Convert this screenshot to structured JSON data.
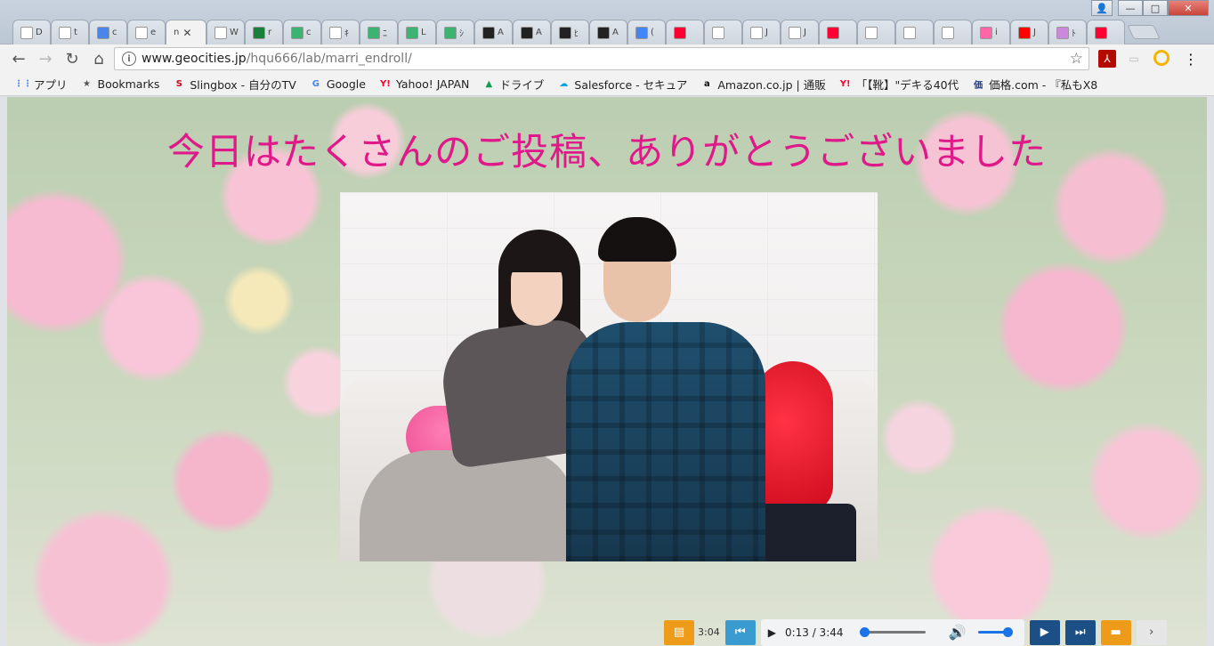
{
  "tabs": [
    {
      "text": "D",
      "icon": "doc-icon",
      "color": "#ffffff"
    },
    {
      "text": "t",
      "icon": "drive-icon",
      "color": "#ffffff"
    },
    {
      "text": "c",
      "icon": "docs-icon",
      "color": "#4a86e8"
    },
    {
      "text": "e",
      "icon": "doc-icon",
      "color": "#ffffff"
    },
    {
      "text": "n",
      "icon": "",
      "color": "#f2f2f2",
      "active": true
    },
    {
      "text": "W",
      "icon": "wiki-icon",
      "color": "#ffffff"
    },
    {
      "text": "r",
      "icon": "sheets-icon",
      "color": "#188038"
    },
    {
      "text": "c",
      "icon": "green-circle-icon",
      "color": "#3cb371"
    },
    {
      "text": "ｷ",
      "icon": "wreath-icon",
      "color": "#ffffff"
    },
    {
      "text": "ﾆ",
      "icon": "green-circle-icon",
      "color": "#3cb371"
    },
    {
      "text": "L",
      "icon": "green-circle-icon",
      "color": "#3cb371"
    },
    {
      "text": "ｼ",
      "icon": "green-circle-icon",
      "color": "#3cb371"
    },
    {
      "text": "A",
      "icon": "dark-badge-icon",
      "color": "#222222"
    },
    {
      "text": "A",
      "icon": "dark-badge-icon",
      "color": "#222222"
    },
    {
      "text": "ﾋ",
      "icon": "dark-badge-icon",
      "color": "#222222"
    },
    {
      "text": "A",
      "icon": "dark-badge-icon",
      "color": "#222222"
    },
    {
      "text": "(",
      "icon": "translate-icon",
      "color": "#4285f4"
    },
    {
      "text": "",
      "icon": "yahoo-icon",
      "color": "#ff0033"
    },
    {
      "text": "",
      "icon": "doc-icon",
      "color": "#ffffff"
    },
    {
      "text": "J",
      "icon": "doc-icon",
      "color": "#ffffff"
    },
    {
      "text": "J",
      "icon": "doc-icon",
      "color": "#ffffff"
    },
    {
      "text": "",
      "icon": "yahoo-icon",
      "color": "#ff0033"
    },
    {
      "text": "",
      "icon": "doc-icon",
      "color": "#ffffff"
    },
    {
      "text": "",
      "icon": "doc-icon",
      "color": "#ffffff"
    },
    {
      "text": "",
      "icon": "doc-icon",
      "color": "#ffffff"
    },
    {
      "text": "i",
      "icon": "pink-face-icon",
      "color": "#ff66aa"
    },
    {
      "text": "J",
      "icon": "youtube-icon",
      "color": "#ff0000"
    },
    {
      "text": "ﾄ",
      "icon": "flower-icon",
      "color": "#cc88dd"
    },
    {
      "text": "",
      "icon": "yahoo-icon",
      "color": "#ff0033"
    }
  ],
  "window": {
    "minimize": "—",
    "maximize": "□",
    "close": "✕",
    "user": "👤"
  },
  "toolbar": {
    "back": "←",
    "forward": "→",
    "reload": "↻",
    "home": "⌂",
    "url_host": "www.geocities.jp",
    "url_path": "/hqu666/lab/marri_endroll/",
    "info": "i",
    "star": "☆",
    "menu": "⋮"
  },
  "bookmarks": [
    {
      "label": "アプリ",
      "icon": "apps-icon",
      "glyph": "⋮⋮",
      "color": "#4285f4"
    },
    {
      "label": "Bookmarks",
      "icon": "star-icon",
      "glyph": "★",
      "color": "#555555"
    },
    {
      "label": "Slingbox - 自分のTV",
      "icon": "slingbox-icon",
      "glyph": "S",
      "color": "#d0021b"
    },
    {
      "label": "Google",
      "icon": "google-icon",
      "glyph": "G",
      "color": "#4285f4"
    },
    {
      "label": "Yahoo! JAPAN",
      "icon": "yahoo-icon",
      "glyph": "Y!",
      "color": "#ff0033"
    },
    {
      "label": "ドライブ",
      "icon": "drive-icon",
      "glyph": "▲",
      "color": "#0f9d58"
    },
    {
      "label": "Salesforce - セキュア",
      "icon": "salesforce-icon",
      "glyph": "☁",
      "color": "#00a1e0"
    },
    {
      "label": "Amazon.co.jp | 通販",
      "icon": "amazon-icon",
      "glyph": "a",
      "color": "#111111"
    },
    {
      "label": "「【靴】\"デキる40代",
      "icon": "yahoo-icon",
      "glyph": "Y!",
      "color": "#ff0033"
    },
    {
      "label": "価格.com - 『私もX8",
      "icon": "kakaku-icon",
      "glyph": "価",
      "color": "#1f3f8f"
    }
  ],
  "page": {
    "headline": "今日はたくさんのご投稿、ありがとうございました"
  },
  "player": {
    "list_btn": "▤",
    "prev_btn": "⏮",
    "play": "▶",
    "time": "0:13 / 3:44",
    "progress": 0.06,
    "volume_icon": "🔊",
    "volume": 1.0,
    "play_btn": "▶",
    "next_btn": "⏭",
    "comment_btn": "▬",
    "more_btn": "›",
    "peek_text": "3:04"
  }
}
